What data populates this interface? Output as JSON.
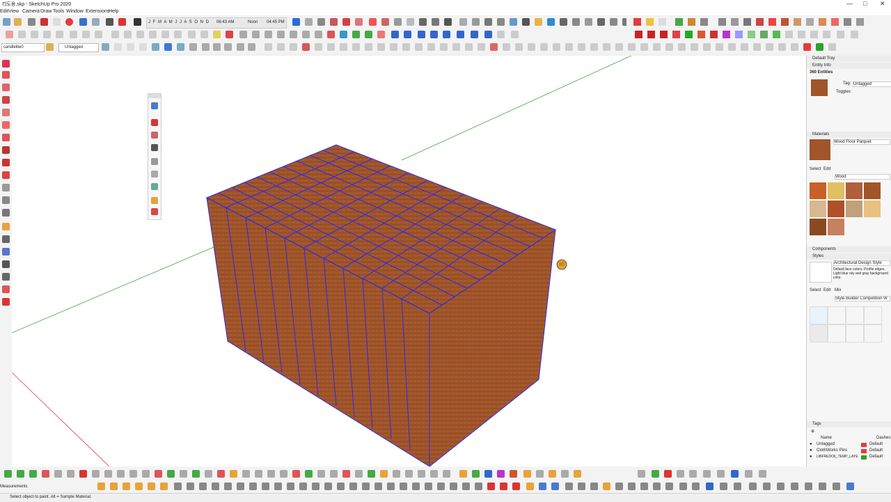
{
  "window": {
    "title": "리도용.skp - SketchUp Pro 2020"
  },
  "menu": [
    "Edit",
    "View",
    "Camera",
    "Draw",
    "Tools",
    "Window",
    "Extensions",
    "Help"
  ],
  "shadow_bar": {
    "months": "J F M A M J J A S O N D",
    "time_start": "06:43 AM",
    "noon": "Noon",
    "time_end": "04:45 PM"
  },
  "tag_toolbar": {
    "layer_dropdown": "candlelite0",
    "tag_label": "Untagged"
  },
  "entity_info": {
    "tray_title": "Default Tray",
    "header": "Entity Info",
    "count": "360 Entities",
    "tag_label": "Tag:",
    "tag_value": "Untagged",
    "toggles_label": "Toggles:"
  },
  "materials": {
    "header": "Materials",
    "current_material": "Wood Floor Parquet",
    "tab_select": "Select",
    "tab_edit": "Edit",
    "library": "Wood"
  },
  "components": {
    "header": "Components"
  },
  "styles": {
    "header": "Styles",
    "style_name": "Architectural Design Style",
    "style_desc": "Default face colors. Profile edges. Light blue sky and gray background color.",
    "tab_select": "Select",
    "tab_edit": "Edit",
    "tab_mix": "Mix",
    "library": "Style Builder Competition W"
  },
  "tags": {
    "header": "Tags",
    "col_name": "Name",
    "col_dashes": "Dashes",
    "rows": [
      {
        "name": "Untagged",
        "dashes": "Default",
        "color": "#e63a3a"
      },
      {
        "name": "ClothWorks Pins",
        "dashes": "Default",
        "color": "#e63a3a"
      },
      {
        "name": "LIBFREDO6_TEMP_LAYE",
        "dashes": "Default",
        "color": "#2aa12a"
      }
    ]
  },
  "status": {
    "measurements_label": "Measurements",
    "hint": "Select object to paint. Alt = Sample Material."
  },
  "colors": {
    "selection_edge": "#2a2af0",
    "wood": "#a0552a",
    "green_axis": "#3aa83a",
    "red_axis": "#d63a3a"
  }
}
